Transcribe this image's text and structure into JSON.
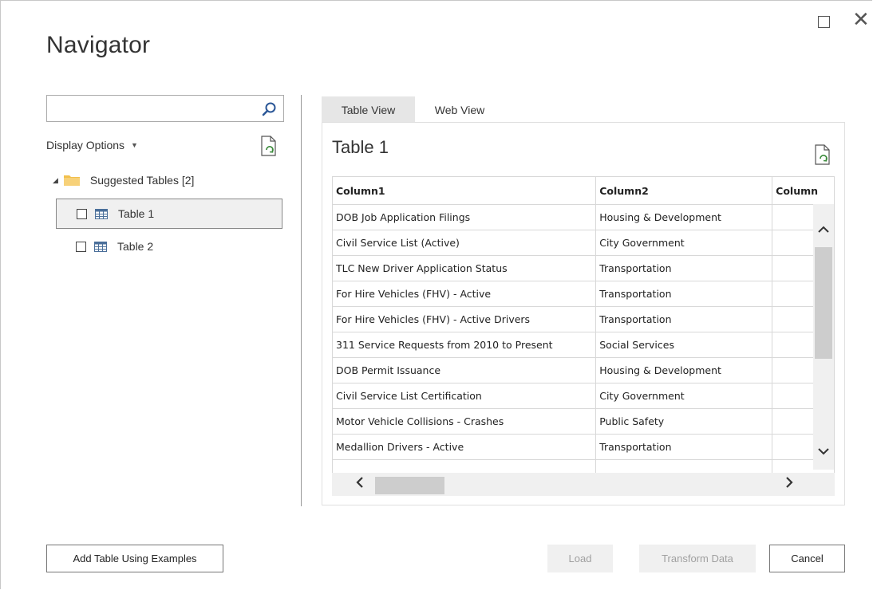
{
  "window": {
    "title": "Navigator"
  },
  "search": {
    "value": "",
    "placeholder": ""
  },
  "display_options": {
    "label": "Display Options",
    "caret": "▼"
  },
  "tree": {
    "root_label": "Suggested Tables [2]",
    "items": [
      {
        "label": "Table 1",
        "selected": true,
        "checked": false
      },
      {
        "label": "Table 2",
        "selected": false,
        "checked": false
      }
    ]
  },
  "tabs": [
    {
      "label": "Table View",
      "active": true
    },
    {
      "label": "Web View",
      "active": false
    }
  ],
  "preview": {
    "title": "Table 1",
    "columns": [
      "Column1",
      "Column2",
      "Column"
    ],
    "rows": [
      [
        "DOB Job Application Filings",
        "Housing & Development",
        ""
      ],
      [
        "Civil Service List (Active)",
        "City Government",
        ""
      ],
      [
        "TLC New Driver Application Status",
        "Transportation",
        ""
      ],
      [
        "For Hire Vehicles (FHV) - Active",
        "Transportation",
        ""
      ],
      [
        "For Hire Vehicles (FHV) - Active Drivers",
        "Transportation",
        ""
      ],
      [
        "311 Service Requests from 2010 to Present",
        "Social Services",
        ""
      ],
      [
        "DOB Permit Issuance",
        "Housing & Development",
        ""
      ],
      [
        "Civil Service List Certification",
        "City Government",
        ""
      ],
      [
        "Motor Vehicle Collisions - Crashes",
        "Public Safety",
        ""
      ],
      [
        "Medallion Drivers - Active",
        "Transportation",
        ""
      ],
      [
        "",
        "",
        ""
      ]
    ]
  },
  "buttons": {
    "add_table": "Add Table Using Examples",
    "load": "Load",
    "transform": "Transform Data",
    "cancel": "Cancel"
  },
  "scroll": {
    "up_arrow": "⌃",
    "down_arrow": "⌄",
    "left_arrow": "❮",
    "right_arrow": "❯"
  },
  "colors": {
    "folder": "#f2c04c",
    "disabled_bg": "#f0f0f0",
    "tab_active_bg": "#e6e6e6"
  }
}
